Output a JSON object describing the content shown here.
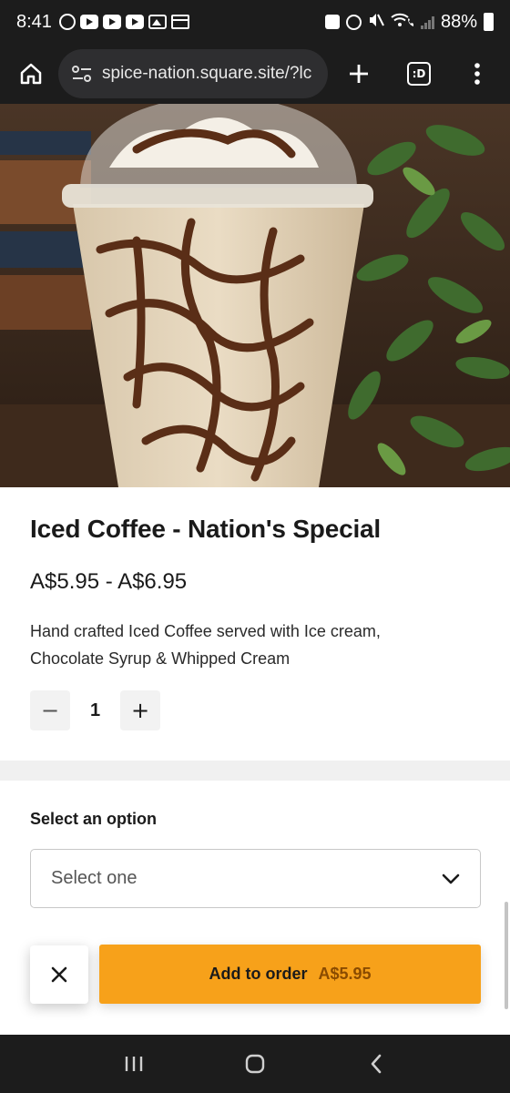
{
  "status_bar": {
    "time": "8:41",
    "battery": "88%",
    "left_icons": [
      "threads-icon",
      "youtube-icon",
      "youtube-icon",
      "youtube-icon",
      "image-icon",
      "window-icon"
    ],
    "right_icons": [
      "lock-icon",
      "alarm-icon",
      "mute-icon",
      "wifi-call-icon",
      "signal-icon",
      "battery-icon"
    ]
  },
  "browser": {
    "url": "spice-nation.square.site/?lc",
    "tab_count": ":D"
  },
  "product": {
    "image_alt": "iced-coffee-photo",
    "title": "Iced Coffee - Nation's Special",
    "price_range": "A$5.95 - A$6.95",
    "description": "Hand crafted Iced Coffee served with Ice cream, Chocolate Syrup & Whipped Cream"
  },
  "quantity": {
    "value": "1",
    "decrement": "−",
    "increment": "+"
  },
  "option": {
    "label": "Select an option",
    "placeholder": "Select one"
  },
  "actions": {
    "add_label": "Add to order",
    "add_price": "A$5.95"
  },
  "colors": {
    "accent": "#f7a11a",
    "system_bar": "#1c1c1c"
  }
}
